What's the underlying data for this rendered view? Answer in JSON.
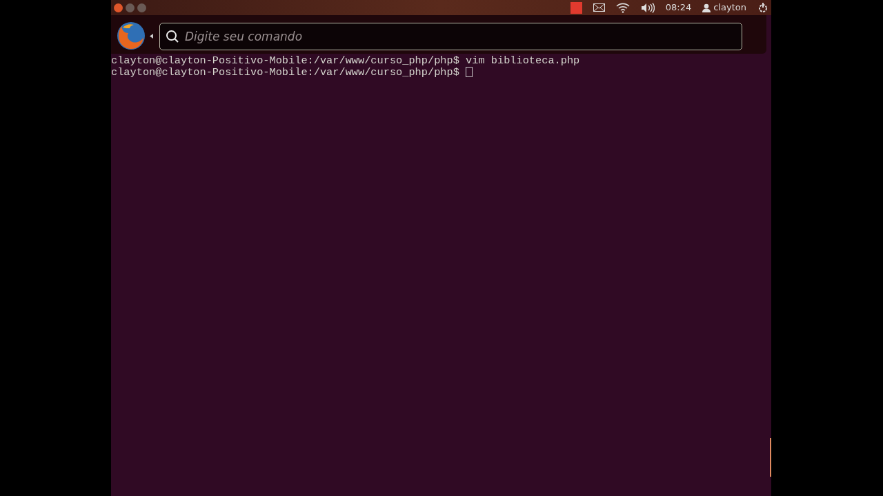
{
  "top_panel": {
    "clock": "08:24",
    "user": "clayton"
  },
  "hud": {
    "search": {
      "placeholder": "Digite seu comando"
    }
  },
  "terminal": {
    "lines": [
      {
        "prompt": "clayton@clayton-Positivo-Mobile:/var/www/curso_php/php$",
        "command": "vim biblioteca.php"
      },
      {
        "prompt": "clayton@clayton-Positivo-Mobile:/var/www/curso_php/php$",
        "cursor": true
      }
    ]
  }
}
